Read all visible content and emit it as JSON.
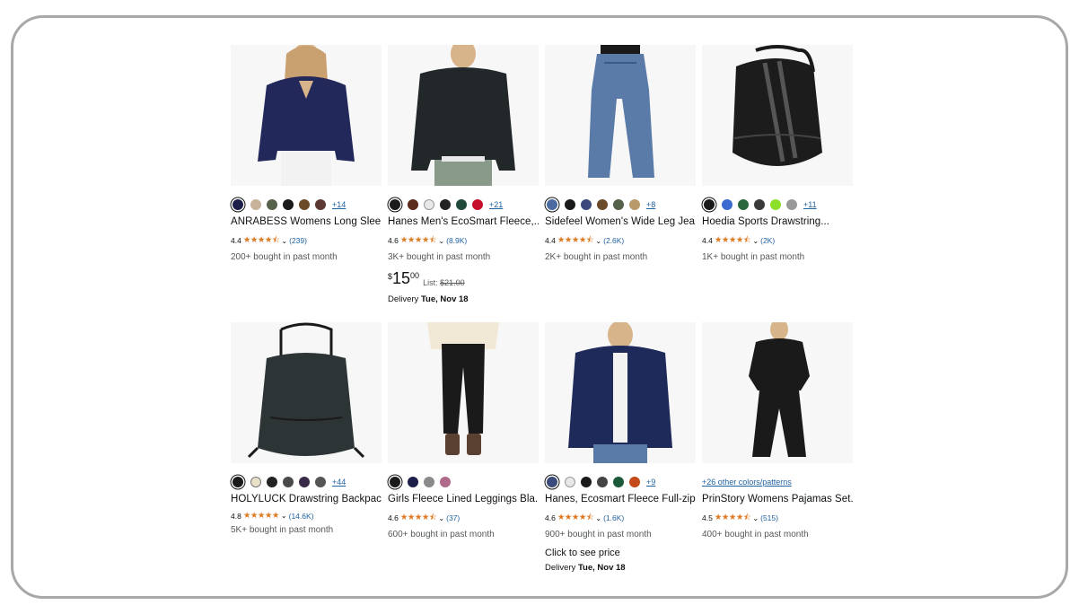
{
  "products": [
    {
      "title": "ANRABESS Womens Long Slee...",
      "rating": "4.4",
      "stars": "★★★★⯪",
      "review_count": "(239)",
      "bought": "200+ bought in past month",
      "more_colors": "+14",
      "swatch_colors": [
        "#1b1f4a",
        "#c7b39a",
        "#55614a",
        "#1a1a1a",
        "#6b4a2a",
        "#5a3a32"
      ],
      "thumb": "navy-sweater"
    },
    {
      "title": "Hanes Men's EcoSmart Fleece,...",
      "rating": "4.6",
      "stars": "★★★★⯪",
      "review_count": "(8.9K)",
      "bought": "3K+ bought in past month",
      "more_colors": "+21",
      "swatch_colors": [
        "#1a1a1a",
        "#5a2a1a",
        "#e8e8e8",
        "#222222",
        "#1f4a3a",
        "#c4122e"
      ],
      "price": {
        "currency": "$",
        "whole": "15",
        "fraction": "00",
        "list_label": "List:",
        "list_price": "$21.00"
      },
      "delivery_label": "Delivery ",
      "delivery_date": "Tue, Nov 18",
      "thumb": "black-sweatshirt"
    },
    {
      "title": "Sidefeel Women's Wide Leg Jea...",
      "rating": "4.4",
      "stars": "★★★★⯪",
      "review_count": "(2.6K)",
      "bought": "2K+ bought in past month",
      "more_colors": "+8",
      "swatch_colors": [
        "#4a6aa0",
        "#1a1a1a",
        "#3b4a7a",
        "#6b4a2a",
        "#55614a",
        "#b89a6a"
      ],
      "thumb": "wide-jeans"
    },
    {
      "title": "Hoedia Sports Drawstring...",
      "rating": "4.4",
      "stars": "★★★★⯪",
      "review_count": "(2K)",
      "bought": "1K+ bought in past month",
      "more_colors": "+11",
      "swatch_colors": [
        "#1a1a1a",
        "#3b6ad0",
        "#2a6a3a",
        "#3a3a3a",
        "#8de02a",
        "#999999"
      ],
      "thumb": "sports-drawstring"
    },
    {
      "title": "HOLYLUCK Drawstring Backpac...",
      "rating": "4.8",
      "stars": "★★★★★",
      "review_count": "(14.6K)",
      "bought": "5K+ bought in past month",
      "more_colors": "+44",
      "swatch_colors": [
        "#1a1a1a",
        "#e8e0c8",
        "#222222",
        "#4a4a4a",
        "#3a2a4a",
        "#555555"
      ],
      "thumb": "drawstring-backpack"
    },
    {
      "title": "Girls Fleece Lined Leggings Bla...",
      "rating": "4.6",
      "stars": "★★★★⯪",
      "review_count": "(37)",
      "bought": "600+ bought in past month",
      "more_colors": "",
      "swatch_colors": [
        "#1a1a1a",
        "#1b1f4a",
        "#8a8a8a",
        "#b06a8a"
      ],
      "thumb": "girls-leggings"
    },
    {
      "title": "Hanes, Ecosmart Fleece Full-zip...",
      "rating": "4.6",
      "stars": "★★★★⯪",
      "review_count": "(1.6K)",
      "bought": "900+ bought in past month",
      "more_colors": "+9",
      "swatch_colors": [
        "#3a4a7a",
        "#e8e8e8",
        "#1a1a1a",
        "#444444",
        "#1a5a3a",
        "#c44a1a"
      ],
      "click_price": "Click to see price",
      "delivery_label": "Delivery ",
      "delivery_date": "Tue, Nov 18",
      "thumb": "navy-zip-hoodie"
    },
    {
      "title": "PrinStory Womens Pajamas Set...",
      "rating": "4.5",
      "stars": "★★★★⯪",
      "review_count": "(515)",
      "bought": "400+ bought in past month",
      "more_colors": "+26 other colors/patterns",
      "swatch_colors": [],
      "thumb": "black-pajamas"
    }
  ]
}
